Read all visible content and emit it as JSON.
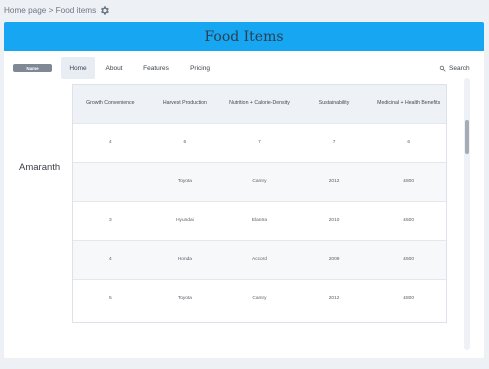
{
  "breadcrumb": {
    "text": "Home page > Food items",
    "icon": "gear-icon"
  },
  "banner": {
    "title": "Food Items",
    "color": "#17a6f1"
  },
  "nav": {
    "brand_label": "Name",
    "tabs": [
      "Home",
      "About",
      "Features",
      "Pricing"
    ],
    "active_tab": "Home",
    "search_label": "Search"
  },
  "row_label": "Amaranth",
  "table": {
    "headers": [
      "Growth Convenience",
      "Harvest Production",
      "Nutrition + Calorie-Density",
      "Sustainability",
      "Medicinal + Health Benefits"
    ],
    "rows": [
      [
        "4",
        "6",
        "7",
        "7",
        "6"
      ],
      [
        "",
        "Toyota",
        "Camry",
        "2012",
        "£800"
      ],
      [
        "3",
        "Hyundai",
        "Elantra",
        "2010",
        "£600"
      ],
      [
        "4",
        "Honda",
        "Accord",
        "2009",
        "£500"
      ],
      [
        "5",
        "Toyota",
        "Camry",
        "2012",
        "£800"
      ]
    ]
  }
}
